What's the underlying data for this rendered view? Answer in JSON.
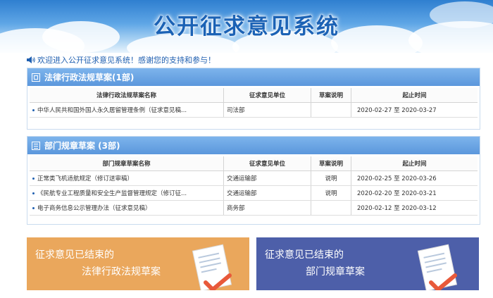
{
  "banner": {
    "title": "公开征求意见系统"
  },
  "welcome": {
    "text": "欢迎进入公开征求意见系统！感谢您的支持和参与！"
  },
  "laws": {
    "title": "法律行政法规草案(1部)",
    "headers": [
      "法律行政法规草案名称",
      "征求意见单位",
      "草案说明",
      "起止时间"
    ],
    "rows": [
      {
        "name": "中华人民共和国外国人永久居留管理条例（征求意见稿...",
        "unit": "司法部",
        "note": "",
        "time": "2020-02-27 至 2020-03-27"
      }
    ]
  },
  "rules": {
    "title": "部门规章草案 (3部)",
    "headers": [
      "部门规章草案名称",
      "征求意见单位",
      "草案说明",
      "起止时间"
    ],
    "rows": [
      {
        "name": "正常类飞机适航规定（修订送审稿）",
        "unit": "交通运输部",
        "note": "说明",
        "time": "2020-02-25 至 2020-03-26"
      },
      {
        "name": "《民航专业工程质量和安全生产监督管理规定（修订征...",
        "unit": "交通运输部",
        "note": "说明",
        "time": "2020-02-20 至 2020-03-21"
      },
      {
        "name": "电子商务信息公示管理办法（征求意见稿）",
        "unit": "商务部",
        "note": "",
        "time": "2020-02-12 至 2020-03-12"
      }
    ]
  },
  "cards": {
    "ended_laws": {
      "line1": "征求意见已结束的",
      "line2": "法律行政法规草案"
    },
    "ended_rules": {
      "line1": "征求意见已结束的",
      "line2": "部门规章草案"
    }
  },
  "colors": {
    "orange_card": "#eaa75c",
    "blue_card": "#4d5fa9",
    "panel_header": "#5b97dc",
    "title_blue": "#1b62b5"
  },
  "icons": [
    "speaker-icon",
    "law-panel-icon",
    "rule-panel-icon",
    "document-check-icon"
  ]
}
